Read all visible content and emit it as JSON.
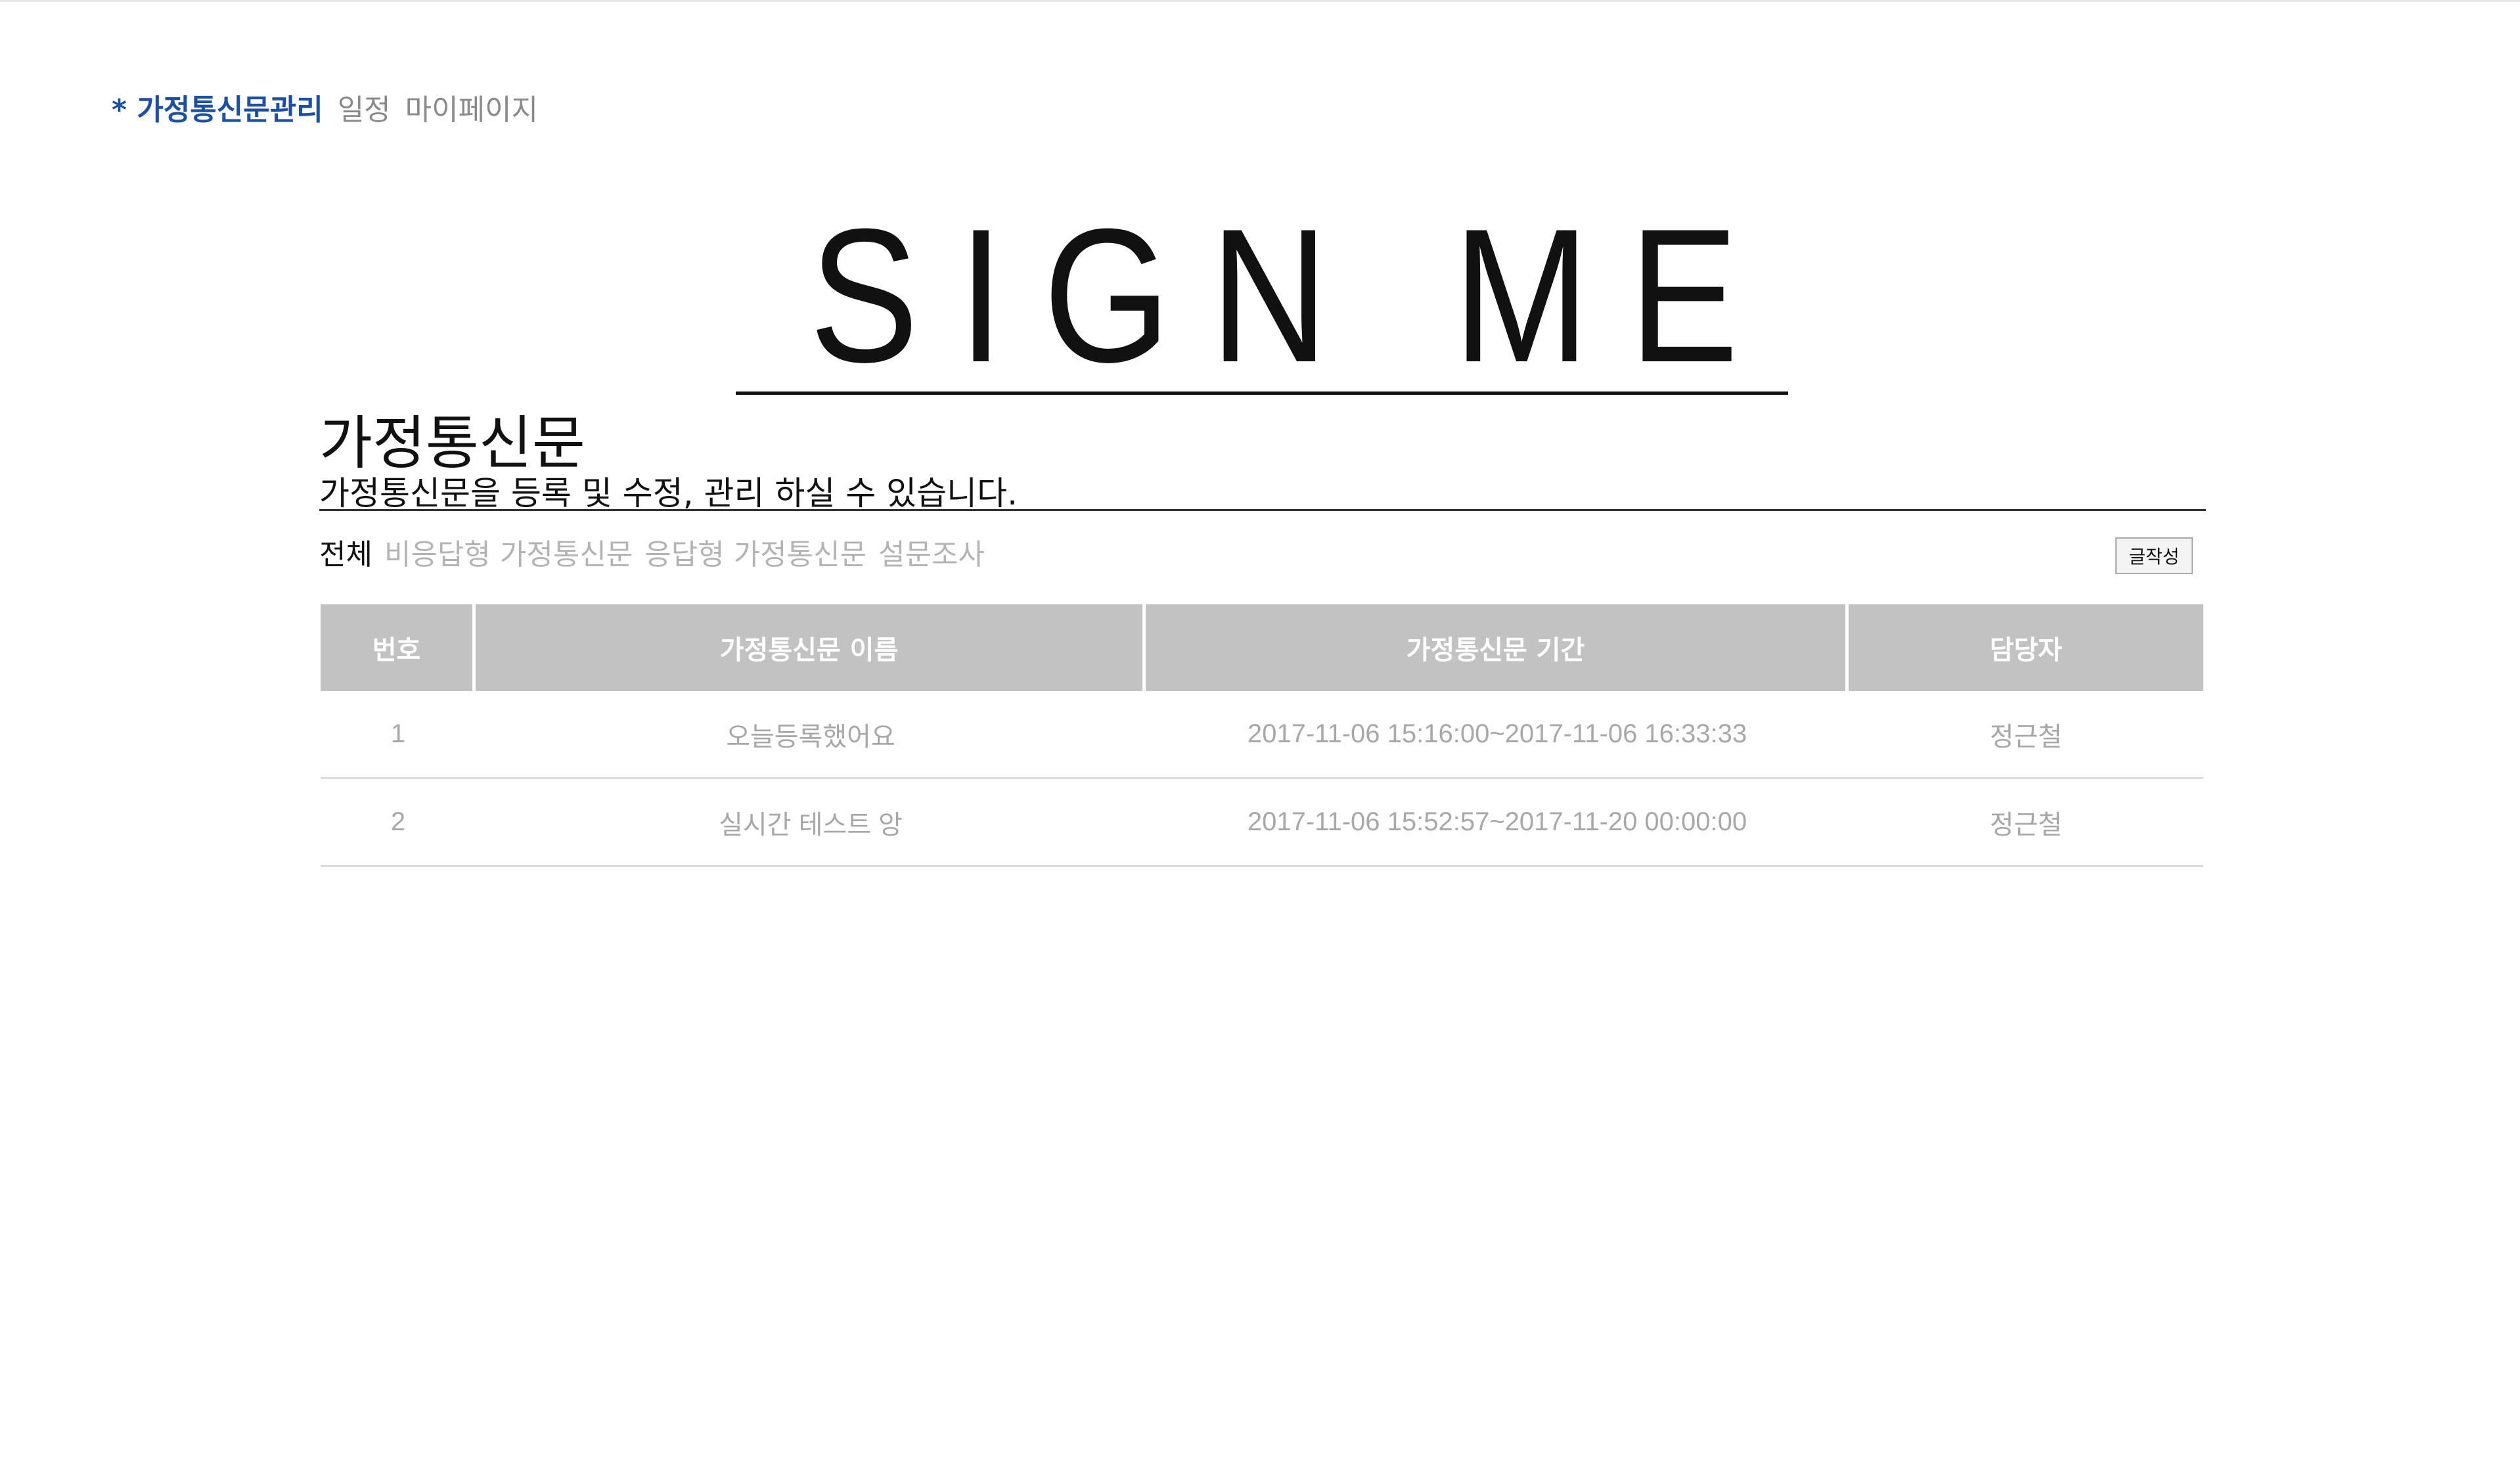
{
  "topnav": {
    "items": [
      {
        "label": "* 가정통신문관리",
        "active": true
      },
      {
        "label": "일정",
        "active": false
      },
      {
        "label": "마이페이지",
        "active": false
      }
    ]
  },
  "logo": {
    "text": "SIGN ME"
  },
  "section": {
    "title": "가정통신문",
    "description": "가정통신문을 등록 및 수정, 관리 하실 수 있습니다."
  },
  "filters": [
    {
      "label": "전체",
      "active": true
    },
    {
      "label": "비응답형 가정통신문",
      "active": false
    },
    {
      "label": "응답형 가정통신문",
      "active": false
    },
    {
      "label": "설문조사",
      "active": false
    }
  ],
  "toolbar": {
    "write_label": "글작성"
  },
  "table": {
    "headers": [
      "번호",
      "가정통신문 이름",
      "가정통신문 기간",
      "담당자"
    ],
    "rows": [
      [
        "1",
        "오늘등록했어요",
        "2017-11-06 15:16:00~2017-11-06 16:33:33",
        "정근철"
      ],
      [
        "2",
        "실시간 테스트 앙",
        "2017-11-06 15:52:57~2017-11-20 00:00:00",
        "정근철"
      ]
    ]
  },
  "colors": {
    "accent": "#1a4fa3",
    "header_bg": "#c2c2c2",
    "muted_text": "#a8a8a8"
  }
}
